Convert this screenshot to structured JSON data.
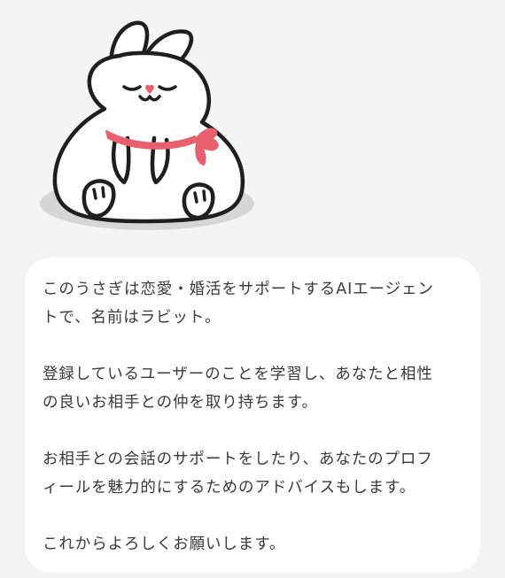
{
  "mascot": {
    "icon": "rabbit-mascot-icon"
  },
  "intro": {
    "paragraphs": [
      "このうさぎは恋愛・婚活をサポートするAIエージェン\nトで、名前はラビット。",
      "登録しているユーザーのことを学習し、あなたと相性\nの良いお相手との仲を取り持ちます。",
      "お相手との会話のサポートをしたり、あなたのプロフ\nィールを魅力的にするためのアドバイスもします。",
      "これからよろしくお願いします。"
    ]
  },
  "colors": {
    "page_background": "#f4f4f4",
    "bubble_background": "#ffffff",
    "text": "#3a3a3a",
    "scarf": "#e8606e",
    "nose": "#e8606e",
    "shadow": "#d6d6d6"
  }
}
